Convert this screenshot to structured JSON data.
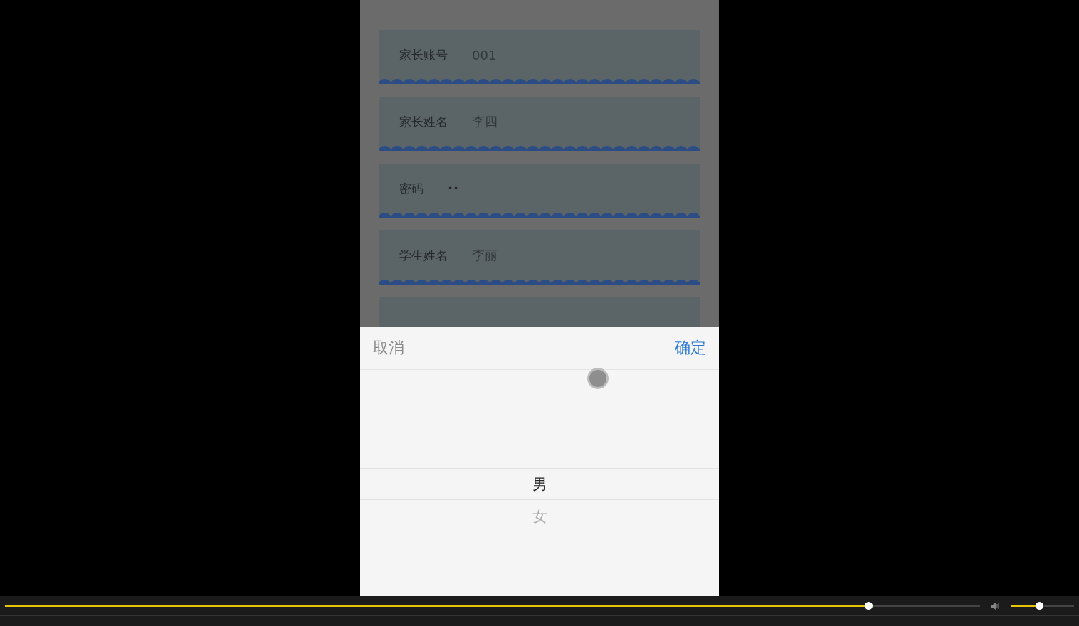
{
  "form": {
    "fields": [
      {
        "label": "家长账号",
        "value": "001",
        "kind": "text"
      },
      {
        "label": "家长姓名",
        "value": "李四",
        "kind": "text"
      },
      {
        "label": "密码",
        "value": "••",
        "kind": "password"
      },
      {
        "label": "学生姓名",
        "value": "李丽",
        "kind": "text"
      },
      {
        "kind": "cut"
      }
    ]
  },
  "picker": {
    "cancel": "取消",
    "confirm": "确定",
    "options": [
      {
        "label": "男",
        "selected": true
      },
      {
        "label": "女",
        "selected": false
      }
    ]
  },
  "player": {
    "seek": {
      "level": 0.885
    },
    "volume": {
      "level": 0.44
    }
  }
}
